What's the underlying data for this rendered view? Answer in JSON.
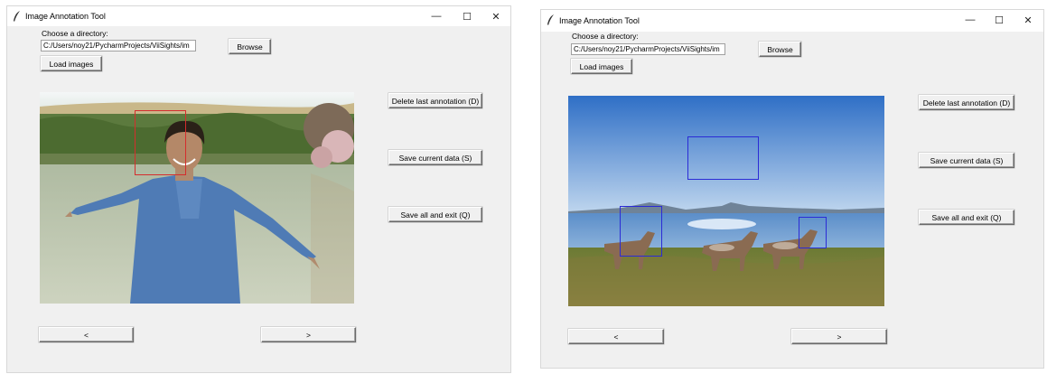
{
  "colors": {
    "window_bg": "#f0f0f0",
    "titlebar_bg": "#ffffff",
    "box_red": "#d42d2d",
    "box_blue": "#2b2bd6"
  },
  "windows": [
    {
      "title": "Image Annotation Tool",
      "controls": {
        "minimize": "—",
        "maximize": "☐",
        "close": "✕"
      },
      "dir_label": "Choose a directory:",
      "dir_value": "C:/Users/noy21/PycharmProjects/ViiSights/im",
      "browse_label": "Browse",
      "load_label": "Load images",
      "delete_label": "Delete last annotation (D)",
      "save_label": "Save current data (S)",
      "exit_label": "Save all and exit (Q)",
      "prev_label": "<",
      "next_label": ">",
      "image_subject": "man-by-lake",
      "annotation_color": "red"
    },
    {
      "title": "Image Annotation Tool",
      "controls": {
        "minimize": "—",
        "maximize": "☐",
        "close": "✕"
      },
      "dir_label": "Choose a directory:",
      "dir_value": "C:/Users/noy21/PycharmProjects/ViiSights/im",
      "browse_label": "Browse",
      "load_label": "Load images",
      "delete_label": "Delete last annotation (D)",
      "save_label": "Save current data (S)",
      "exit_label": "Save all and exit (Q)",
      "prev_label": "<",
      "next_label": ">",
      "image_subject": "horses-by-lake",
      "annotation_color": "blue"
    }
  ]
}
